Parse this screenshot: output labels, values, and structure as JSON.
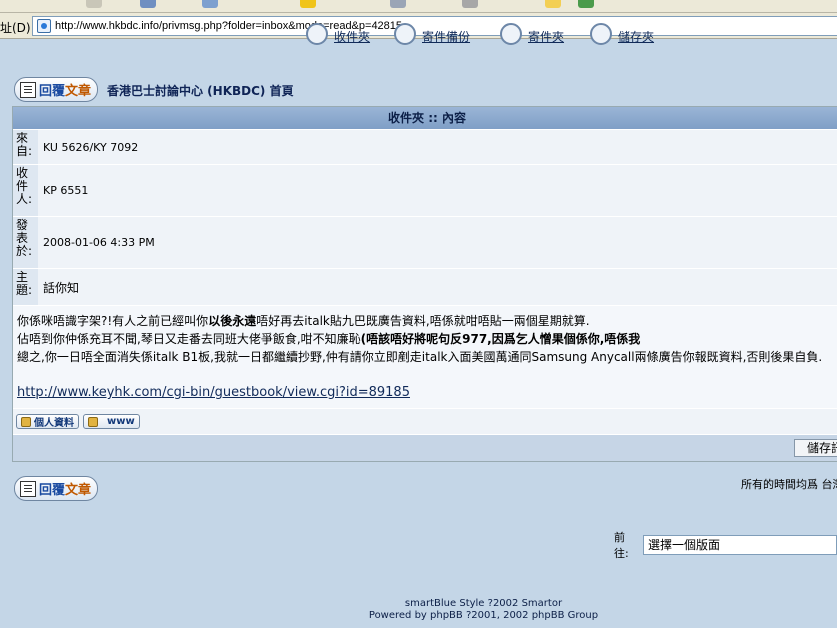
{
  "browser": {
    "address_label": "址(D)",
    "url": "http://www.hkbdc.info/privmsg.php?folder=inbox&mode=read&p=42815"
  },
  "topnav": {
    "items": [
      {
        "label": "收件夾"
      },
      {
        "label": "寄件備份"
      },
      {
        "label": "寄件夾"
      },
      {
        "label": "儲存夾"
      }
    ]
  },
  "reply_button": {
    "label_a": "回覆",
    "label_b": "文章"
  },
  "forum_title": "香港巴士討論中心 (HKBDC) 首頁",
  "section_title": "收件夾 :: 內容",
  "fields": {
    "from_label": "來自:",
    "from_value": "KU 5626/KY 7092",
    "to_label": "收件人:",
    "to_value": "KP 6551",
    "date_label": "發表於:",
    "date_value": "2008-01-06 4:33 PM",
    "subject_label": "主題:",
    "subject_value": "話你知"
  },
  "message": {
    "line1_a": "你係咪唔識字架?!有人之前已經叫你",
    "line1_b": "以後永遠",
    "line1_c": "唔好再去italk貼九巴既廣告資料,唔係就咁唔貼一兩個星期就算.",
    "line2_a": "佔唔到你仲係充耳不聞,琴日又走番去同班大佬爭飯食,咁不知廉恥",
    "line2_b": "(唔該唔好將呢句反977,因爲乞人憎果個係你,唔係我",
    "line3": "總之,你一日唔全面消失係italk B1板,我就一日都繼續抄野,仲有請你立即剷走italk入面美國萬通同Samsung Anycall兩條廣告你報既資料,否則後果自負.",
    "link": "http://www.keyhk.com/cgi-bin/guestbook/view.cgi?id=89185"
  },
  "profile_buttons": {
    "profile": "個人資料",
    "www": "www"
  },
  "save_button": "儲存訊息",
  "timezone_text": "所有的時間均爲 台灣時間",
  "jump": {
    "label": "前往:",
    "selected": "選擇一個版面"
  },
  "footer": {
    "line1": "smartBlue Style ?2002 Smartor",
    "line2": "Powered by phpBB ?2001, 2002 phpBB Group"
  }
}
